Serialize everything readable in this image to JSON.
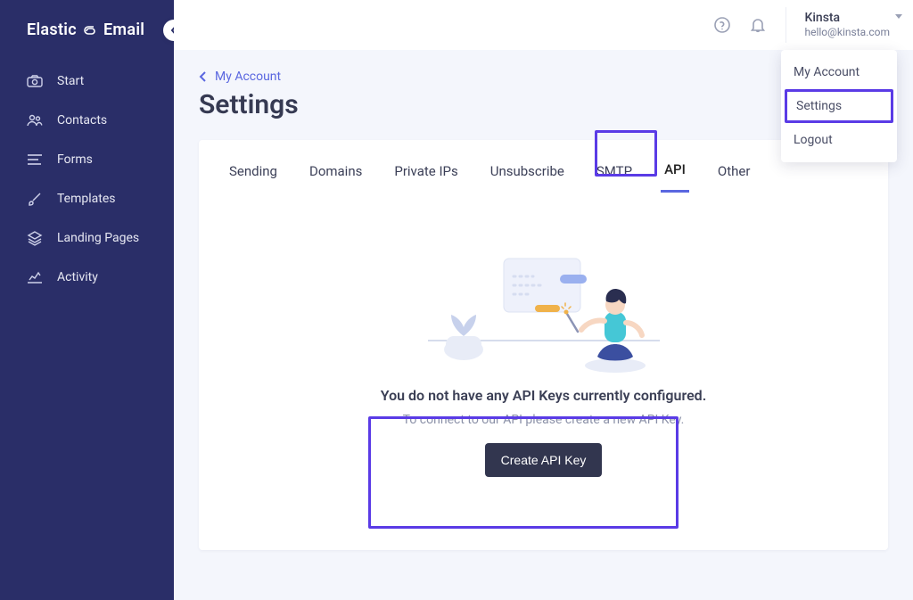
{
  "brand": {
    "name_a": "Elastic",
    "name_b": "Email"
  },
  "sidebar": {
    "items": [
      {
        "label": "Start",
        "icon": "home"
      },
      {
        "label": "Contacts",
        "icon": "contacts"
      },
      {
        "label": "Forms",
        "icon": "forms"
      },
      {
        "label": "Templates",
        "icon": "templates"
      },
      {
        "label": "Landing Pages",
        "icon": "layers"
      },
      {
        "label": "Activity",
        "icon": "activity"
      }
    ]
  },
  "topbar": {
    "account_name": "Kinsta",
    "account_email": "hello@kinsta.com"
  },
  "breadcrumb": {
    "label": "My Account"
  },
  "page": {
    "title": "Settings"
  },
  "tabs": [
    {
      "label": "Sending"
    },
    {
      "label": "Domains"
    },
    {
      "label": "Private IPs"
    },
    {
      "label": "Unsubscribe"
    },
    {
      "label": "SMTP"
    },
    {
      "label": "API",
      "active": true
    },
    {
      "label": "Other"
    }
  ],
  "empty_state": {
    "title": "You do not have any API Keys currently configured.",
    "subtitle": "To connect to our API please create a new API Key.",
    "cta": "Create API Key"
  },
  "account_menu": [
    {
      "label": "My Account"
    },
    {
      "label": "Settings",
      "highlighted": true
    },
    {
      "label": "Logout"
    }
  ]
}
